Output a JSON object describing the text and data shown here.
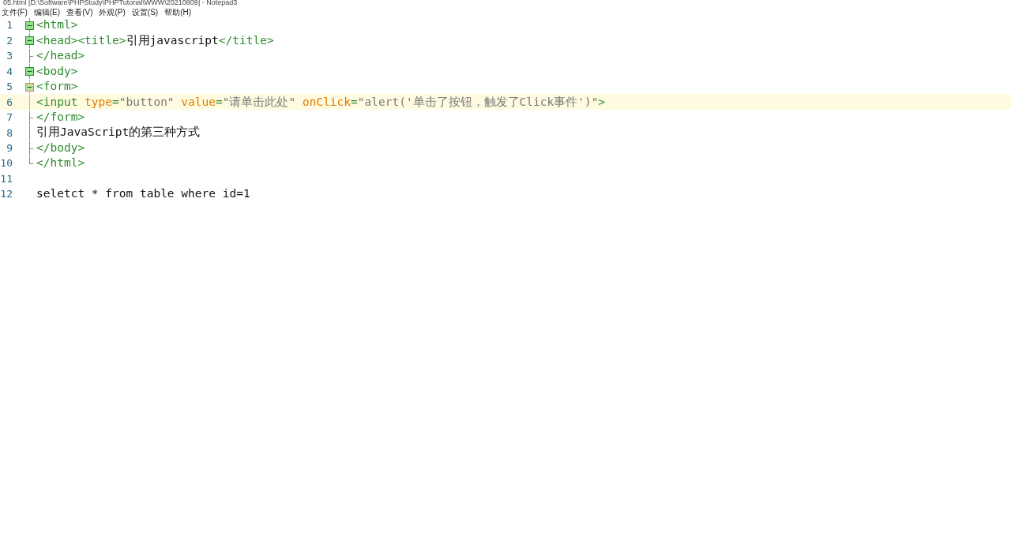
{
  "window": {
    "title": "05.html [D:\\Software\\PHPStudy\\PHPTutorial\\WWW\\20210809] - Notepad3"
  },
  "menu": [
    {
      "label": "文件(F)"
    },
    {
      "label": "编辑(E)"
    },
    {
      "label": "查看(V)"
    },
    {
      "label": "外观(P)"
    },
    {
      "label": "设置(S)"
    },
    {
      "label": "帮助(H)"
    }
  ],
  "editor": {
    "lines": [
      {
        "number": "1",
        "kind": "open",
        "highlighted": false,
        "tokens": [
          {
            "kind": "tag",
            "text": "<html>"
          }
        ]
      },
      {
        "number": "2",
        "kind": "open",
        "highlighted": false,
        "tokens": [
          {
            "kind": "tag",
            "text": "<head><title>"
          },
          {
            "kind": "text",
            "text": "引用javascript"
          },
          {
            "kind": "tag",
            "text": "</title>"
          }
        ]
      },
      {
        "number": "3",
        "kind": "branch",
        "highlighted": false,
        "tokens": [
          {
            "kind": "tag",
            "text": "</head>"
          }
        ]
      },
      {
        "number": "4",
        "kind": "open",
        "highlighted": false,
        "tokens": [
          {
            "kind": "tag",
            "text": "<body>"
          }
        ]
      },
      {
        "number": "5",
        "kind": "open_active",
        "highlighted": false,
        "tokens": [
          {
            "kind": "tag",
            "text": "<form>"
          }
        ]
      },
      {
        "number": "6",
        "kind": "line_active",
        "highlighted": true,
        "tokens": [
          {
            "kind": "tag",
            "text": "<input "
          },
          {
            "kind": "attr",
            "text": "type"
          },
          {
            "kind": "tag",
            "text": "="
          },
          {
            "kind": "string",
            "text": "\"button\" "
          },
          {
            "kind": "attr",
            "text": "value"
          },
          {
            "kind": "tag",
            "text": "="
          },
          {
            "kind": "string",
            "text": "\"请单击此处\" "
          },
          {
            "kind": "attr",
            "text": "onClick"
          },
          {
            "kind": "tag",
            "text": "="
          },
          {
            "kind": "string",
            "text": "\"alert('单击了按钮，触发了Click事件')\""
          },
          {
            "kind": "tag",
            "text": ">"
          }
        ]
      },
      {
        "number": "7",
        "kind": "branch",
        "highlighted": false,
        "tokens": [
          {
            "kind": "tag",
            "text": "</form>"
          }
        ]
      },
      {
        "number": "8",
        "kind": "line",
        "highlighted": false,
        "tokens": [
          {
            "kind": "text",
            "text": "引用JavaScript的第三种方式"
          }
        ]
      },
      {
        "number": "9",
        "kind": "branch",
        "highlighted": false,
        "tokens": [
          {
            "kind": "tag",
            "text": "</body>"
          }
        ]
      },
      {
        "number": "10",
        "kind": "end",
        "highlighted": false,
        "tokens": [
          {
            "kind": "tag",
            "text": "</html>"
          }
        ]
      },
      {
        "number": "11",
        "kind": "none",
        "highlighted": false
      },
      {
        "number": "12",
        "kind": "none",
        "highlighted": false,
        "tokens": [
          {
            "kind": "text",
            "text": "seletct * from table where id=1"
          }
        ]
      }
    ]
  }
}
